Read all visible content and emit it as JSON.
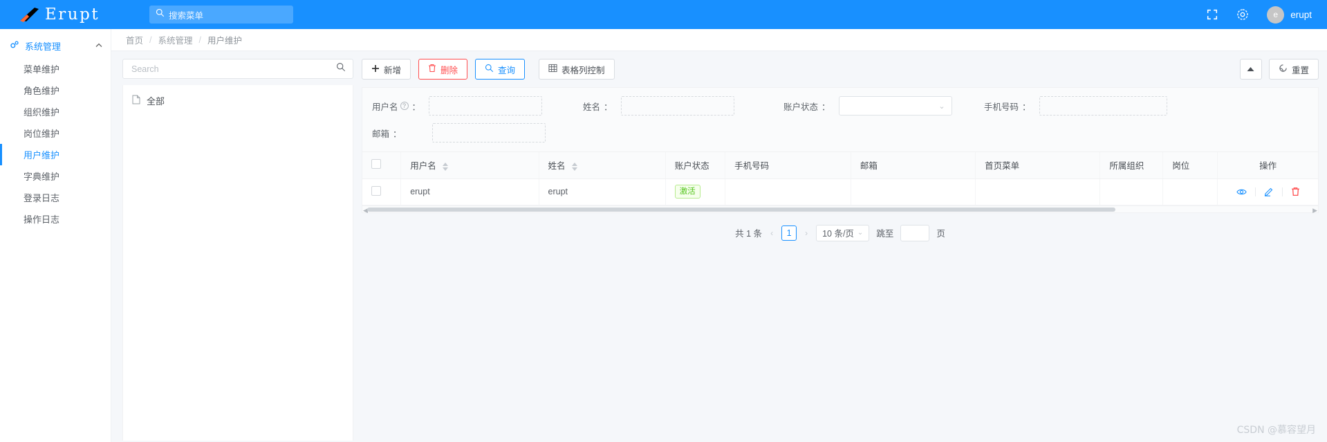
{
  "header": {
    "brand": "Erupt",
    "search_placeholder": "搜索菜单",
    "search_icon": "search-icon",
    "fullscreen_icon": "fullscreen-icon",
    "settings_icon": "gear-icon",
    "avatar_letter": "e",
    "user_name": "erupt"
  },
  "sidebar": {
    "group": {
      "label": "系统管理",
      "icon": "gears-icon",
      "caret": "⌃"
    },
    "items": [
      {
        "label": "菜单维护",
        "active": false
      },
      {
        "label": "角色维护",
        "active": false
      },
      {
        "label": "组织维护",
        "active": false
      },
      {
        "label": "岗位维护",
        "active": false
      },
      {
        "label": "用户维护",
        "active": true
      },
      {
        "label": "字典维护",
        "active": false
      },
      {
        "label": "登录日志",
        "active": false
      },
      {
        "label": "操作日志",
        "active": false
      }
    ]
  },
  "breadcrumb": {
    "items": [
      "首页",
      "系统管理",
      "用户维护"
    ],
    "separator": "/"
  },
  "tree": {
    "search_placeholder": "Search",
    "search_icon": "search-icon",
    "nodes": [
      {
        "label": "全部",
        "icon": "file-icon"
      }
    ]
  },
  "toolbar": {
    "add_label": "新增",
    "add_icon": "plus-icon",
    "delete_label": "删除",
    "delete_icon": "trash-icon",
    "query_label": "查询",
    "query_icon": "search-icon",
    "columns_label": "表格列控制",
    "columns_icon": "table-icon",
    "collapse_icon": "caret-up-icon",
    "reset_label": "重置",
    "reset_icon": "refresh-icon"
  },
  "search_form": {
    "fields": [
      {
        "label": "用户名",
        "colon": "：",
        "value": "",
        "help": "?",
        "type": "input"
      },
      {
        "label": "姓名",
        "colon": "：",
        "value": "",
        "type": "input"
      },
      {
        "label": "账户状态",
        "colon": "：",
        "value": "",
        "type": "select",
        "chevron": "⌄"
      },
      {
        "label": "手机号码",
        "colon": "：",
        "value": "",
        "type": "input"
      },
      {
        "label": "邮箱",
        "colon": "：",
        "value": "",
        "type": "input"
      }
    ]
  },
  "table": {
    "columns": [
      {
        "label": "用户名",
        "sortable": true
      },
      {
        "label": "姓名",
        "sortable": true
      },
      {
        "label": "账户状态",
        "sortable": false
      },
      {
        "label": "手机号码",
        "sortable": false
      },
      {
        "label": "邮箱",
        "sortable": false
      },
      {
        "label": "首页菜单",
        "sortable": false
      },
      {
        "label": "所属组织",
        "sortable": false
      },
      {
        "label": "岗位",
        "sortable": false
      },
      {
        "label": "操作",
        "sortable": false
      }
    ],
    "rows": [
      {
        "username": "erupt",
        "name": "erupt",
        "status": "激活",
        "phone": "",
        "email": "",
        "home_menu": "",
        "org": "",
        "post": "",
        "ops": [
          "view-icon",
          "edit-icon",
          "delete-icon"
        ]
      }
    ]
  },
  "pagination": {
    "total_text": "共 1 条",
    "prev": "‹",
    "current_page": "1",
    "next": "›",
    "page_size": "10 条/页",
    "page_size_chevron": "⌄",
    "jump_label": "跳至",
    "jump_value": "",
    "page_unit": "页"
  },
  "watermark": "CSDN @慕容望月"
}
